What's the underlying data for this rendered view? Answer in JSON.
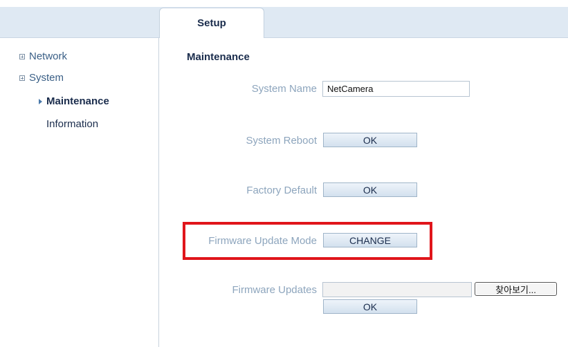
{
  "tabs": [
    {
      "label": "Setup"
    }
  ],
  "sidebar": {
    "items": [
      {
        "label": "Network"
      },
      {
        "label": "System"
      }
    ],
    "subitems": [
      {
        "label": "Maintenance"
      },
      {
        "label": "Information"
      }
    ]
  },
  "main": {
    "section_title": "Maintenance",
    "system_name": {
      "label": "System Name",
      "value": "NetCamera"
    },
    "system_reboot": {
      "label": "System Reboot",
      "button": "OK"
    },
    "factory_default": {
      "label": "Factory Default",
      "button": "OK"
    },
    "firmware_update_mode": {
      "label": "Firmware Update Mode",
      "button": "CHANGE"
    },
    "firmware_updates": {
      "label": "Firmware Updates",
      "browse_button": "찾아보기...",
      "button": "OK",
      "file_value": ""
    }
  },
  "colors": {
    "highlight": "#e0151b",
    "accent": "#3a5f86",
    "label": "#8da5bd"
  }
}
